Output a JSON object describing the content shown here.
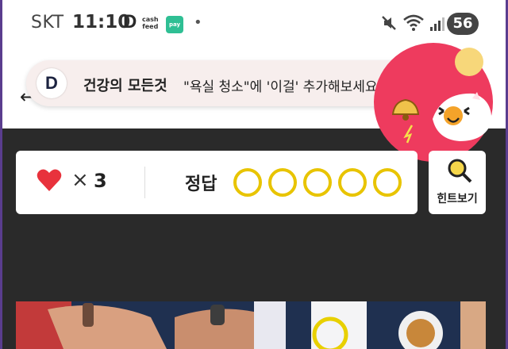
{
  "status_bar": {
    "carrier": "SKT",
    "time": "11:10",
    "app_letter": "D",
    "cashfeed_line1": "cash",
    "cashfeed_line2": "feed",
    "pay_label": "pay",
    "dot": "•",
    "battery": "56"
  },
  "notification": {
    "app_icon_letter": "D",
    "app_name": "건강의 모든것",
    "message": "\"욕실 청소\"에 '이걸' 추가해보세요, 욕실..."
  },
  "quiz": {
    "back": "←",
    "lives_symbol": "×",
    "lives": "3",
    "answer_label": "정답",
    "answer_slots": 5,
    "hint_label": "힌트보기"
  },
  "colors": {
    "heart": "#e8323c",
    "circle_border": "#e8c400",
    "bubble": "#ee3b5e",
    "background": "#2a2a2a"
  }
}
